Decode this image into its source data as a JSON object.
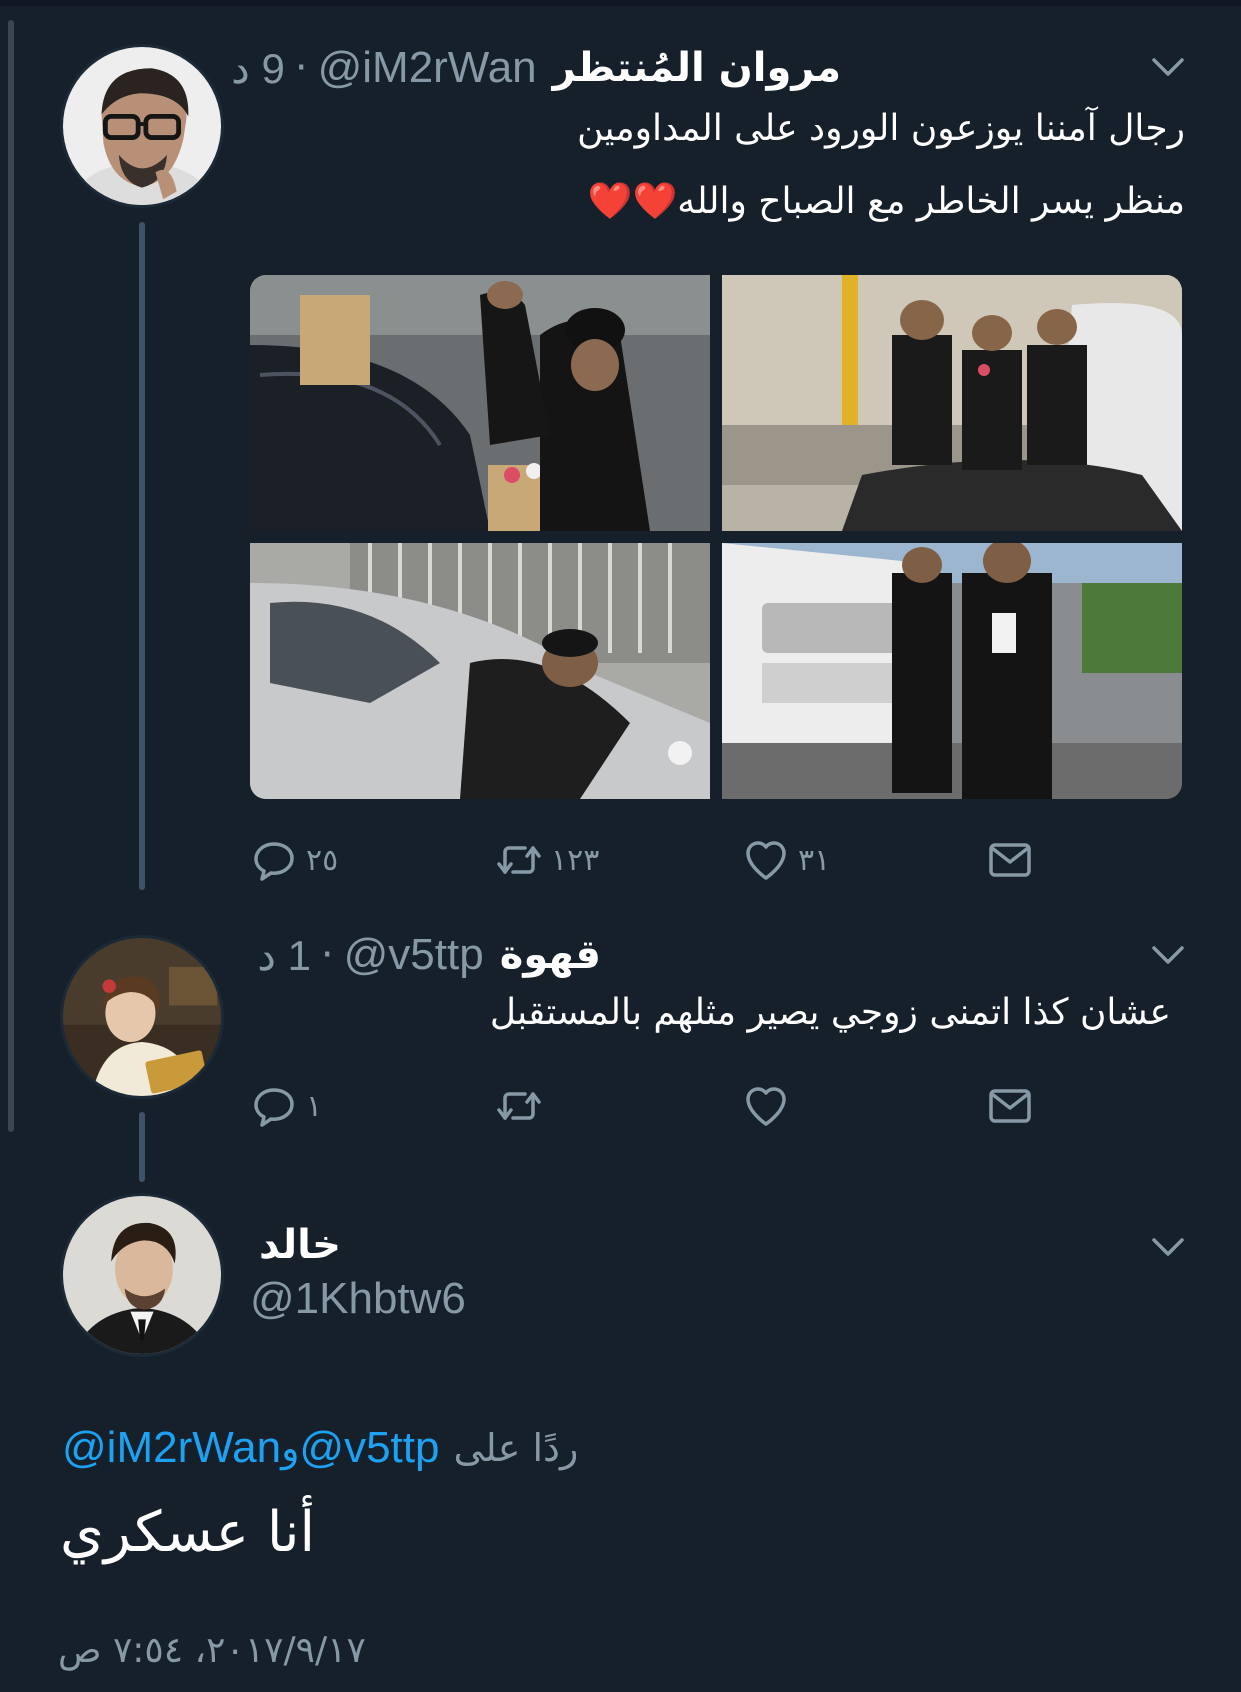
{
  "tweets": [
    {
      "display_name": "مروان المُنتظر",
      "handle": "@iM2rWan",
      "time_ago": "9 د",
      "text_lines": [
        "رجال آمننا يوزعون الورود على المداومين",
        "منظر يسر الخاطر مع الصباح والله❤️❤️"
      ],
      "media_count": 4,
      "actions": {
        "reply_count": "٢٥",
        "retweet_count": "١٢٣",
        "like_count": "٣١"
      }
    },
    {
      "display_name": "قهوة",
      "handle": "@v5ttp",
      "time_ago": "1 د",
      "text_lines": [
        "عشان كذا اتمنى زوجي يصير مثلهم بالمستقبل"
      ],
      "actions": {
        "reply_count": "١",
        "retweet_count": "",
        "like_count": ""
      }
    }
  ],
  "focused_tweet": {
    "display_name": "خالد",
    "handle": "@1Khbtw6",
    "reply_prefix": "ردًا على",
    "reply_to": [
      "@v5ttp",
      "@iM2rWan"
    ],
    "reply_conjunction": "و",
    "text": "أنا عسكري",
    "timestamp": "٢٠١٧/٩/١٧، ٧:٥٤ ص"
  },
  "icons": {
    "reply": "reply-icon",
    "retweet": "retweet-icon",
    "like": "heart-icon",
    "dm": "envelope-icon",
    "menu": "chevron-down-icon"
  },
  "colors": {
    "background": "#15202b",
    "text": "#ffffff",
    "secondary": "#8899a6",
    "link": "#1da1f2",
    "thread_line": "#3d5466"
  }
}
